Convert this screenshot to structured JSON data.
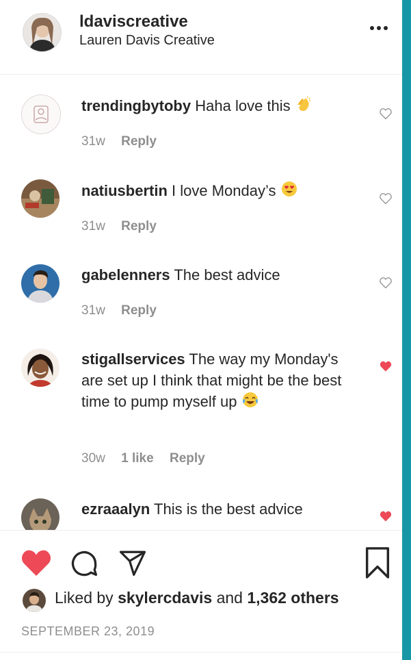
{
  "post": {
    "username": "ldaviscreative",
    "display_name": "Lauren Davis Creative",
    "more_icon": "more-horizontal-icon"
  },
  "comments": [
    {
      "username": "trendingbytoby",
      "text": "Haha love this",
      "emoji": "clap",
      "time": "31w",
      "likes": "",
      "reply": "Reply",
      "liked": false
    },
    {
      "username": "natiusbertin",
      "text": "I love Monday’s",
      "emoji": "heart-eyes",
      "time": "31w",
      "likes": "",
      "reply": "Reply",
      "liked": false
    },
    {
      "username": "gabelenners",
      "text": "The best advice",
      "emoji": "",
      "time": "31w",
      "likes": "",
      "reply": "Reply",
      "liked": false
    },
    {
      "username": "stigallservices",
      "text": "The way my Monday's are set up I think that might be the best time to pump myself up",
      "emoji": "joy",
      "time": "30w",
      "likes": "1 like",
      "reply": "Reply",
      "liked": true
    },
    {
      "username": "ezraaalyn",
      "text": "This is the best advice",
      "emoji": "",
      "time": "",
      "likes": "",
      "reply": "",
      "liked": true
    }
  ],
  "actions": {
    "like_icon": "heart-filled-icon",
    "comment_icon": "comment-icon",
    "share_icon": "share-icon",
    "save_icon": "bookmark-icon"
  },
  "likes": {
    "prefix": "Liked by",
    "user": "skylercdavis",
    "joiner": "and",
    "count": "1,362 others"
  },
  "date": "SEPTEMBER 23, 2019",
  "colors": {
    "heart_red": "#ed4956",
    "muted_text": "#8e8e8e",
    "text": "#262626",
    "teal_border": "#1797a6"
  }
}
